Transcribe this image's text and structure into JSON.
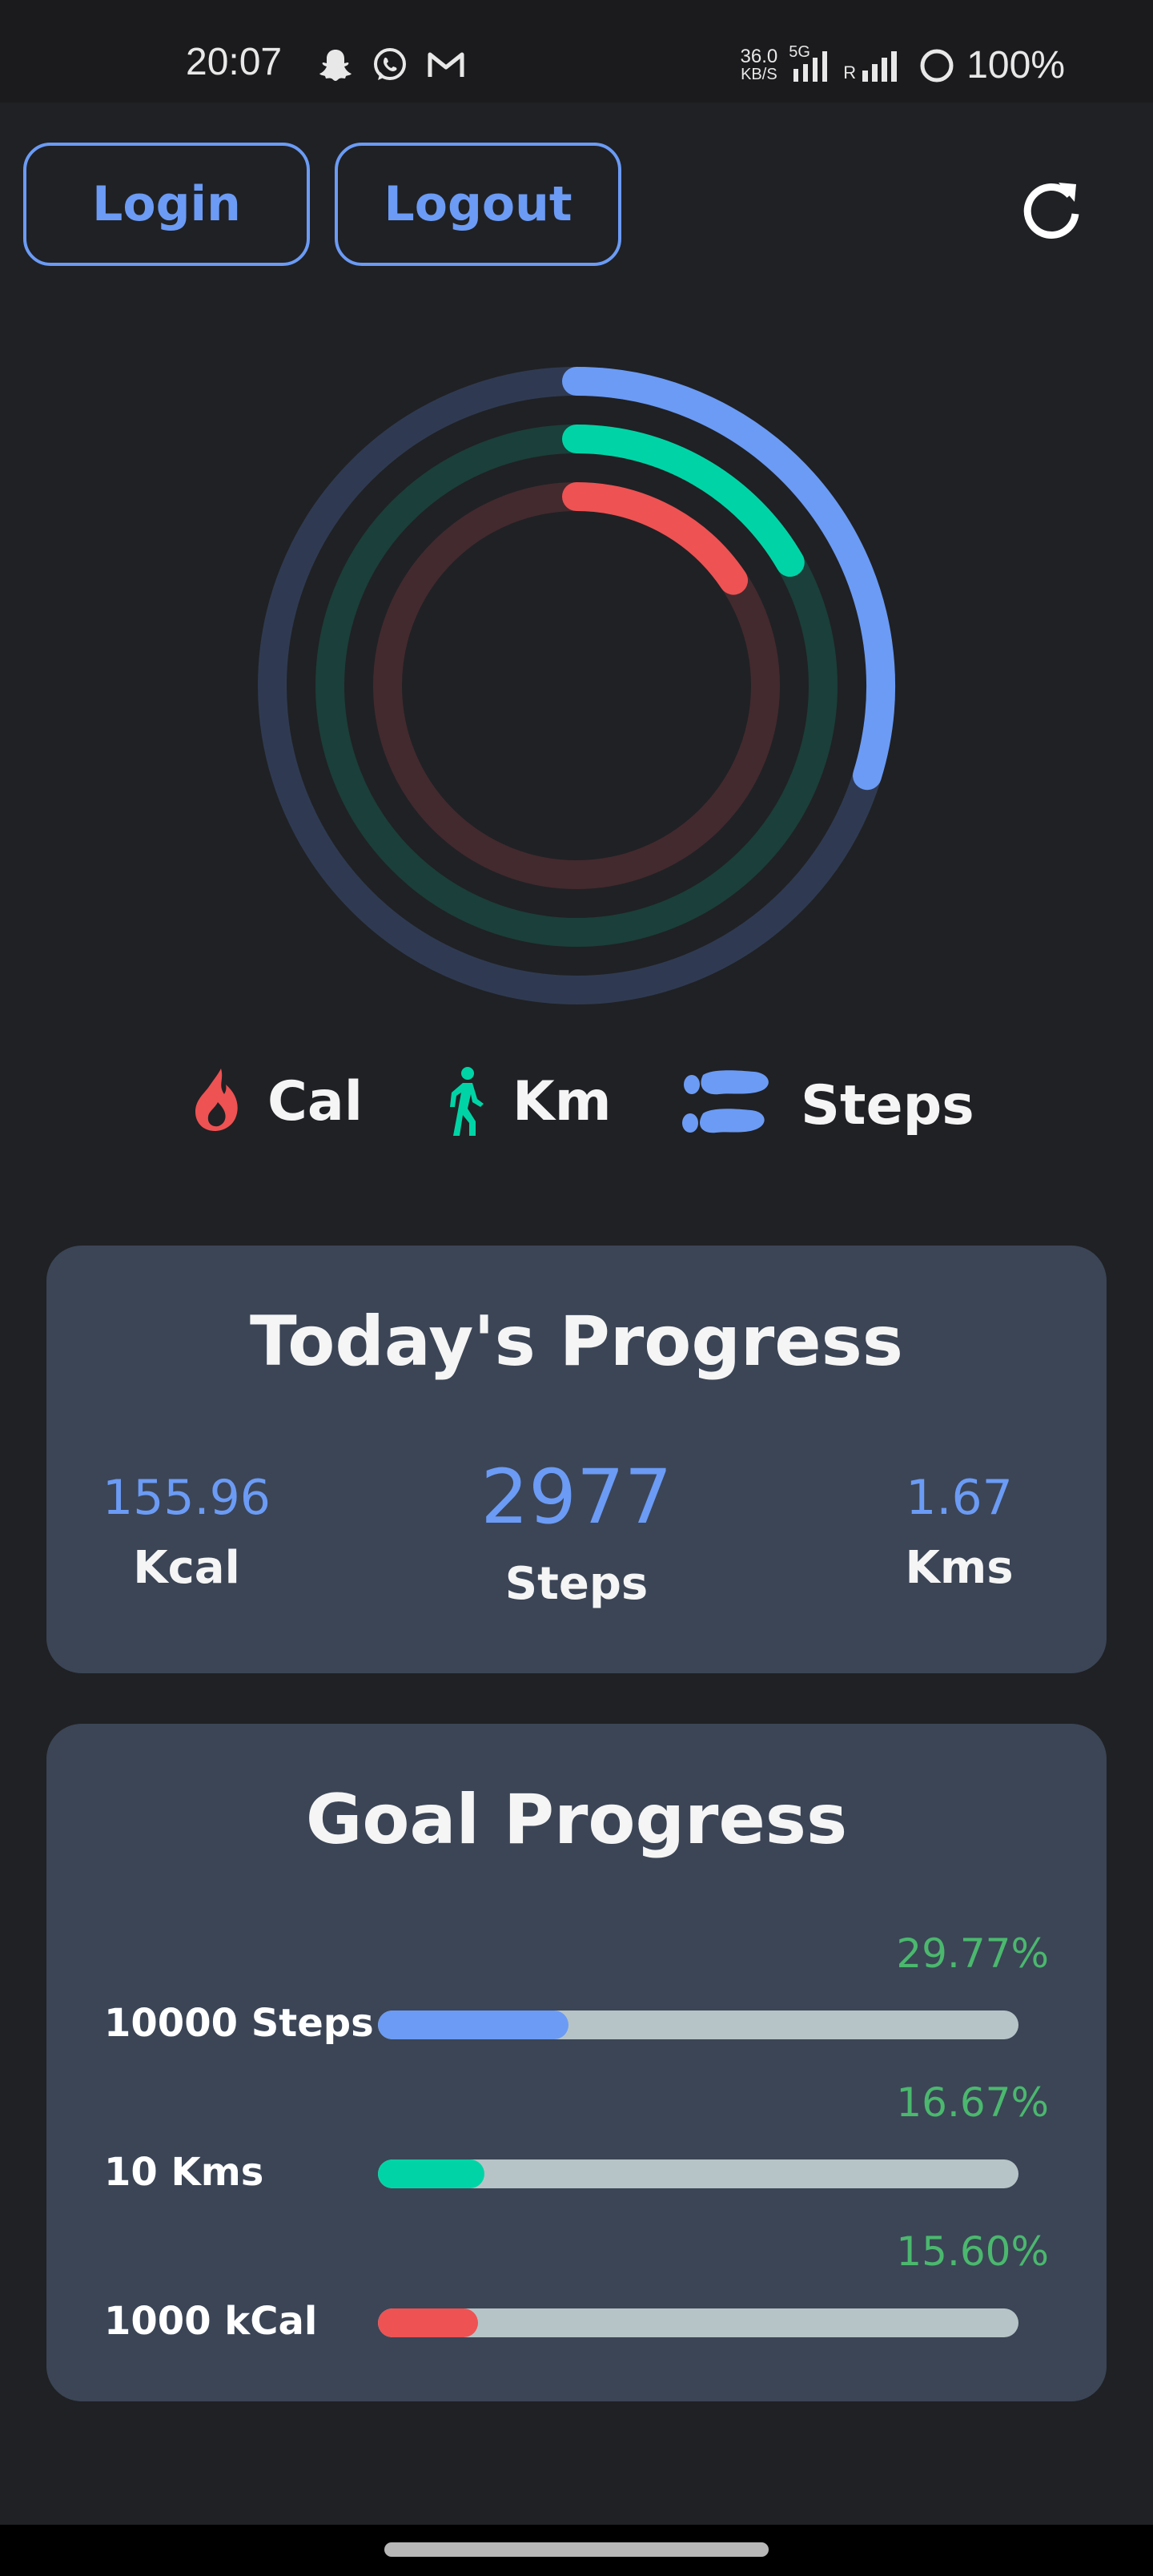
{
  "status_bar": {
    "time": "20:07",
    "net_speed_value": "36.0",
    "net_speed_unit": "KB/S",
    "network_type": "5G",
    "roaming": "R",
    "battery": "100%",
    "icons": [
      "snapchat-icon",
      "whatsapp-icon",
      "gmail-icon",
      "signal-icon",
      "battery-icon"
    ]
  },
  "header": {
    "login_label": "Login",
    "logout_label": "Logout",
    "refresh_icon": "refresh-icon"
  },
  "rings": {
    "steps_fraction": 0.2977,
    "km_fraction": 0.1667,
    "cal_fraction": 0.156,
    "colors": {
      "steps": "#6b9bf5",
      "steps_track": "#2f3a52",
      "km": "#00d4a6",
      "km_track": "#1b3f3a",
      "cal": "#ee5253",
      "cal_track": "#432a2f"
    }
  },
  "legend": {
    "cal": "Cal",
    "km": "Km",
    "steps": "Steps"
  },
  "today": {
    "title": "Today's Progress",
    "kcal_value": "155.96",
    "kcal_label": "Kcal",
    "steps_value": "2977",
    "steps_label": "Steps",
    "kms_value": "1.67",
    "kms_label": "Kms"
  },
  "goal": {
    "title": "Goal Progress",
    "items": [
      {
        "label": "10000 Steps",
        "percent": "29.77%",
        "fraction": 0.2977,
        "color": "#6b9bf5"
      },
      {
        "label": "10 Kms",
        "percent": "16.67%",
        "fraction": 0.1667,
        "color": "#00d4a6"
      },
      {
        "label": "1000 kCal",
        "percent": "15.60%",
        "fraction": 0.156,
        "color": "#ee5253"
      }
    ]
  }
}
